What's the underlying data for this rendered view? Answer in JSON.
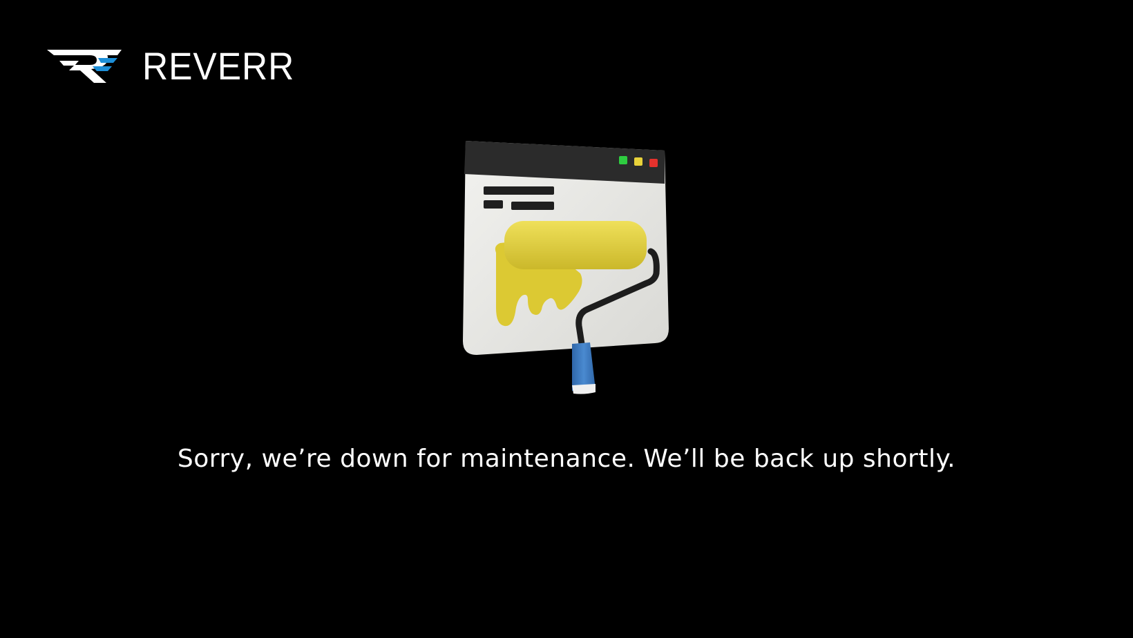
{
  "brand": {
    "name": "REVERR",
    "logo_icon": "reverr-logo-icon",
    "colors": {
      "logo_white": "#ffffff",
      "logo_blue": "#1d8fd8"
    }
  },
  "illustration": {
    "icon": "paint-roller-browser-icon",
    "window_buttons": [
      "green",
      "yellow",
      "red"
    ],
    "colors": {
      "window_bar": "#2b2b2b",
      "window_body": "#e9e9e6",
      "paint": "#e6d43a",
      "handle": "#3f7fc4",
      "btn_green": "#2ecc40",
      "btn_yellow": "#e8d23a",
      "btn_red": "#e5322d"
    }
  },
  "message": {
    "text": "Sorry, we’re down for maintenance. We’ll be back up shortly."
  }
}
